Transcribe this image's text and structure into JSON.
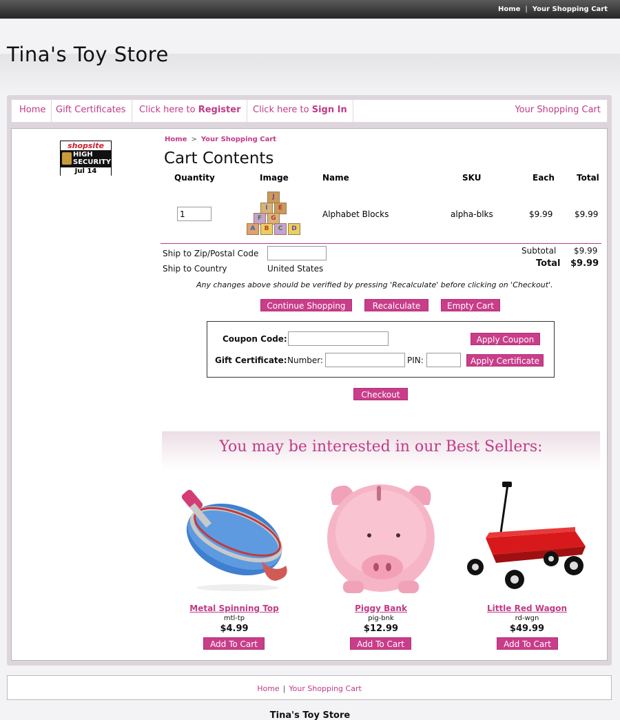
{
  "topbar": {
    "home": "Home",
    "separator": "|",
    "cart": "Your Shopping Cart"
  },
  "header": {
    "store_name": "Tina's Toy Store"
  },
  "nav": {
    "home": "Home",
    "gift": "Gift Certificates",
    "register_prefix": "Click here to ",
    "register_bold": "Register",
    "signin_prefix": "Click here to ",
    "signin_bold": "Sign In",
    "cart": "Your Shopping Cart"
  },
  "badge": {
    "logo": "shopsite",
    "line1": "HIGH",
    "line2": "SECURITY",
    "date": "Jul 14"
  },
  "breadcrumb": {
    "home": "Home",
    "sep": ">",
    "current": "Your Shopping Cart"
  },
  "cart": {
    "title": "Cart Contents",
    "headers": {
      "quantity": "Quantity",
      "image": "Image",
      "name": "Name",
      "sku": "SKU",
      "each": "Each",
      "total": "Total"
    },
    "item": {
      "quantity": "1",
      "name": "Alphabet Blocks",
      "sku": "alpha-blks",
      "each": "$9.99",
      "total": "$9.99",
      "block_letters": [
        "J",
        "I",
        "E",
        "F",
        "G",
        "A",
        "B",
        "C",
        "D"
      ]
    },
    "ship_zip_label": "Ship to Zip/Postal Code",
    "ship_country_label": "Ship to Country",
    "ship_country_value": "United States",
    "subtotal_label": "Subtotal",
    "subtotal_value": "$9.99",
    "total_label": "Total",
    "total_value": "$9.99",
    "note": "Any changes above should be verified by pressing 'Recalculate' before clicking on 'Checkout'."
  },
  "buttons": {
    "continue": "Continue Shopping",
    "recalculate": "Recalculate",
    "empty": "Empty Cart",
    "apply_coupon": "Apply Coupon",
    "apply_certificate": "Apply Certificate",
    "checkout": "Checkout"
  },
  "coupon": {
    "coupon_label": "Coupon Code:",
    "gift_label": "Gift Certificate:",
    "number_label": "Number:",
    "pin_label": "PIN:"
  },
  "best_sellers": {
    "title": "You may be interested in our Best Sellers:",
    "products": [
      {
        "name": "Metal Spinning Top",
        "sku": "mtl-tp",
        "price": "$4.99",
        "button": "Add To Cart"
      },
      {
        "name": "Piggy Bank",
        "sku": "pig-bnk",
        "price": "$12.99",
        "button": "Add To Cart"
      },
      {
        "name": "Little Red Wagon",
        "sku": "rd-wgn",
        "price": "$49.99",
        "button": "Add To Cart"
      }
    ]
  },
  "footer": {
    "home": "Home",
    "separator": "|",
    "cart": "Your Shopping Cart",
    "store_name": "Tina's Toy Store"
  }
}
